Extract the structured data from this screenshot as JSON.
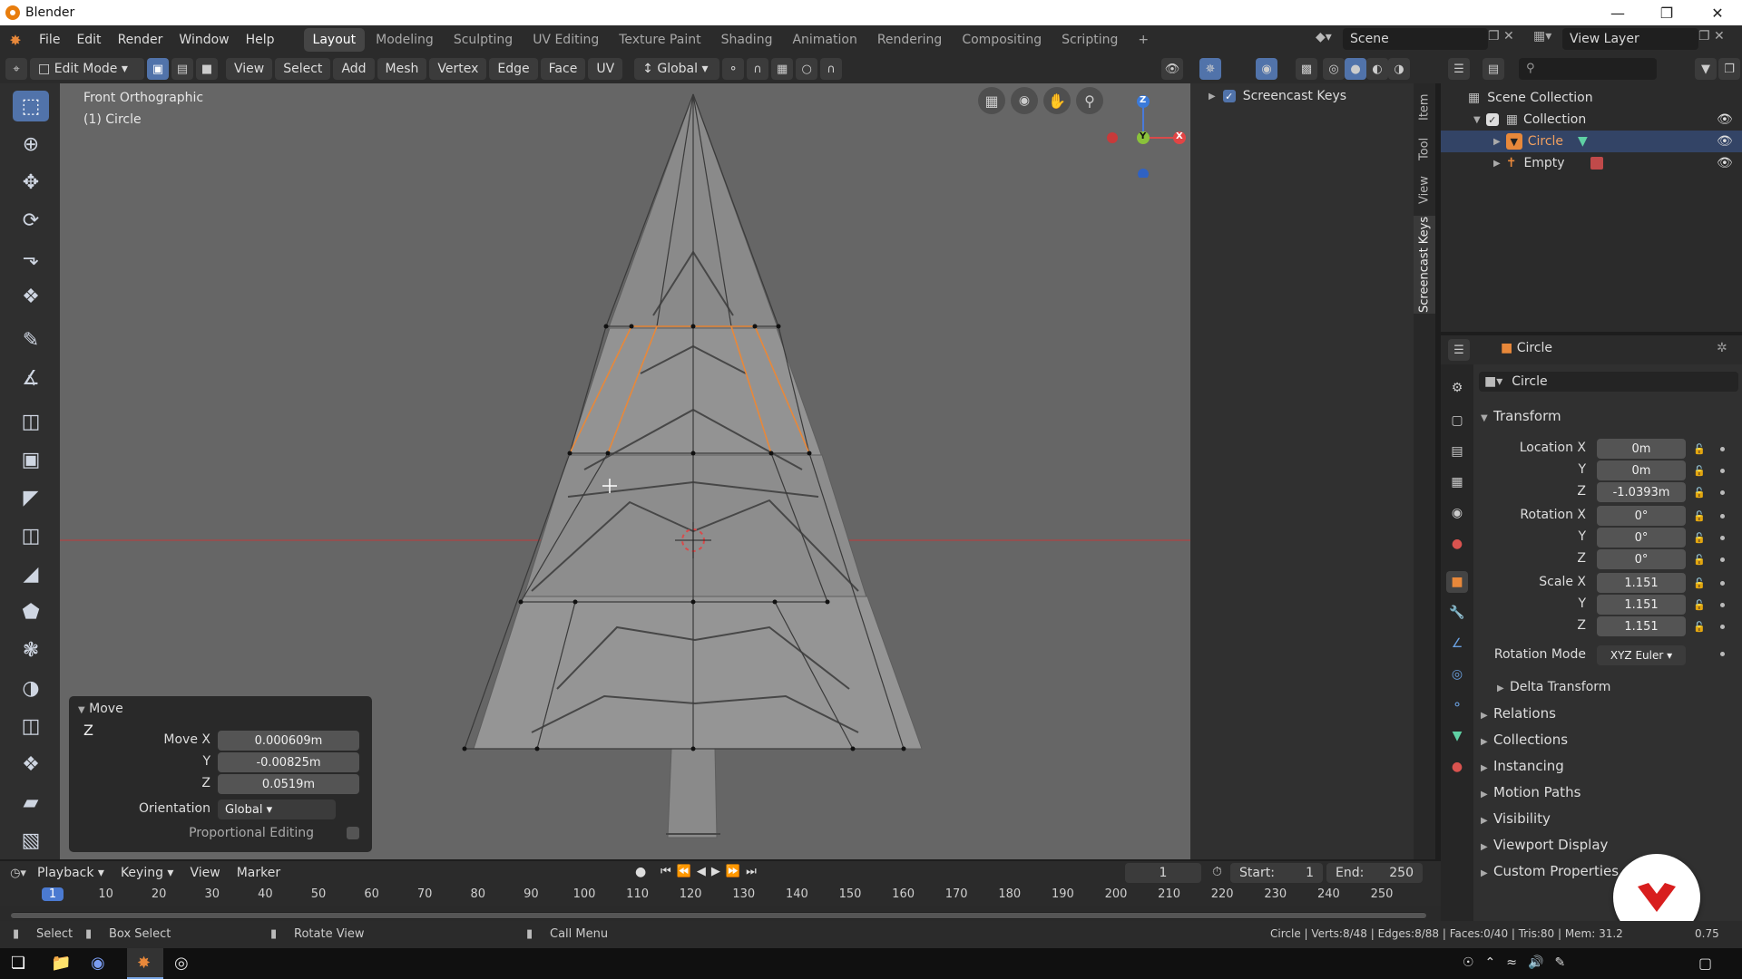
{
  "window": {
    "title": "Blender"
  },
  "menu": [
    "File",
    "Edit",
    "Render",
    "Window",
    "Help"
  ],
  "workspaces": [
    "Layout",
    "Modeling",
    "Sculpting",
    "UV Editing",
    "Texture Paint",
    "Shading",
    "Animation",
    "Rendering",
    "Compositing",
    "Scripting"
  ],
  "scene": {
    "name": "Scene",
    "view_layer": "View Layer"
  },
  "header": {
    "mode": "Edit Mode",
    "menus": [
      "View",
      "Select",
      "Add",
      "Mesh",
      "Vertex",
      "Edge",
      "Face",
      "UV"
    ],
    "orientation": "Global"
  },
  "viewport": {
    "view_name": "Front Orthographic",
    "object_label": "(1) Circle",
    "gizmo": {
      "z": "Z",
      "y": "Y",
      "x": "X"
    },
    "colors": {
      "bg": "#666666",
      "mesh": "#8e8e8e",
      "selected": "#e8883a",
      "x_axis": "#d94a4a"
    }
  },
  "npanel": {
    "section": "Screencast Keys",
    "tabs": [
      "Item",
      "Tool",
      "View",
      "Screencast Keys"
    ]
  },
  "outliner": {
    "root": "Scene Collection",
    "collection": "Collection",
    "objects": [
      "Circle",
      "Empty"
    ]
  },
  "properties": {
    "object_name": "Circle",
    "data_name": "Circle",
    "transform_title": "Transform",
    "location": {
      "label": "Location X",
      "x": "0m",
      "y": "0m",
      "z": "-1.0393m"
    },
    "rotation": {
      "label": "Rotation X",
      "x": "0°",
      "y": "0°",
      "z": "0°"
    },
    "scale": {
      "label": "Scale X",
      "x": "1.151",
      "y": "1.151",
      "z": "1.151"
    },
    "axis_y": "Y",
    "axis_z": "Z",
    "rotation_mode_label": "Rotation Mode",
    "rotation_mode": "XYZ Euler",
    "delta": "Delta Transform",
    "sections": [
      "Relations",
      "Collections",
      "Instancing",
      "Motion Paths",
      "Visibility",
      "Viewport Display",
      "Custom Properties"
    ]
  },
  "operator": {
    "title": "Move",
    "axis": "Z",
    "move_x_label": "Move X",
    "y_label": "Y",
    "z_label": "Z",
    "x": "0.000609m",
    "y": "-0.00825m",
    "z": "0.0519m",
    "orientation_label": "Orientation",
    "orientation": "Global",
    "proportional": "Proportional Editing"
  },
  "timeline": {
    "menus": [
      "Playback",
      "Keying",
      "View",
      "Marker"
    ],
    "current_frame": "1",
    "start_label": "Start:",
    "start": "1",
    "end_label": "End:",
    "end": "250",
    "ticks": [
      "1",
      "10",
      "20",
      "30",
      "40",
      "50",
      "60",
      "70",
      "80",
      "90",
      "100",
      "110",
      "120",
      "130",
      "140",
      "150",
      "160",
      "170",
      "180",
      "190",
      "200",
      "210",
      "220",
      "230",
      "240",
      "250"
    ]
  },
  "status": {
    "select": "Select",
    "box_select": "Box Select",
    "rotate_view": "Rotate View",
    "call_menu": "Call Menu",
    "stats": "Circle | Verts:8/48 | Edges:8/88 | Faces:0/40 | Tris:80 | Mem: 31.2",
    "version": "0.75"
  }
}
